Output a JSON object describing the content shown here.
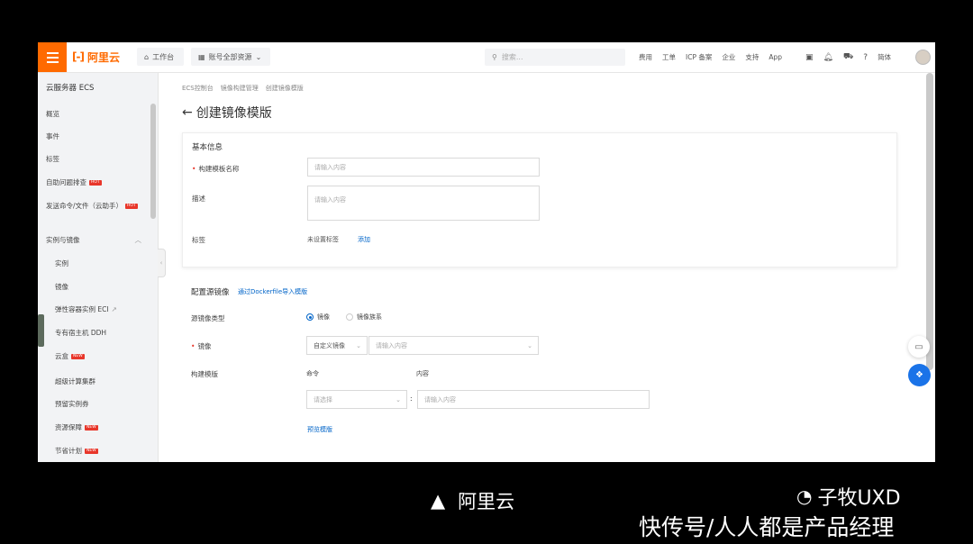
{
  "topbar": {
    "logo_text": "阿里云",
    "workbench": "工作台",
    "account_resources": "账号全部资源",
    "search_placeholder": "搜索...",
    "nav_links": [
      "费用",
      "工单",
      "ICP 备案",
      "企业",
      "支持",
      "App"
    ],
    "lang": "简体"
  },
  "sidebar": {
    "title": "云服务器 ECS",
    "top_items": [
      "概览",
      "事件",
      "标签",
      "自助问题排查",
      "发送命令/文件（云助手）"
    ],
    "section_label": "实例与镜像",
    "sub_items": [
      "实例",
      "镜像",
      "弹性容器实例 ECI",
      "专有宿主机 DDH",
      "云盒",
      "超级计算集群",
      "预留实例券",
      "资源保障",
      "节省计划"
    ],
    "hot_badge": "HOT",
    "new_badge": "NEW"
  },
  "breadcrumb": [
    "ECS控制台",
    "镜像构建管理",
    "创建镜像模版"
  ],
  "page": {
    "title": "创建镜像模版"
  },
  "basic": {
    "section_title": "基本信息",
    "name_label": "构建模板名称",
    "name_placeholder": "请输入内容",
    "desc_label": "描述",
    "desc_placeholder": "请输入内容",
    "tag_label": "标签",
    "tag_value": "未设置标签",
    "tag_add": "添加"
  },
  "source": {
    "section_title": "配置源镜像",
    "import_link": "通过Dockerfile导入模版",
    "type_label": "源镜像类型",
    "type_options": [
      "镜像",
      "镜像族系"
    ],
    "image_label": "镜像",
    "image_select": "自定义镜像",
    "image_placeholder": "请输入内容",
    "build_label": "构建模版",
    "col_command": "命令",
    "col_content": "内容",
    "command_placeholder": "请选择",
    "content_placeholder": "请输入内容",
    "separator": ":",
    "preview_link": "预览模版"
  },
  "caption": {
    "triangle": "▲",
    "text": "阿里云"
  },
  "watermark": {
    "author": "子牧UXD",
    "site": "快传号/人人都是产品经理"
  },
  "colors": {
    "brand": "#ff6a00",
    "link": "#0064c8"
  }
}
